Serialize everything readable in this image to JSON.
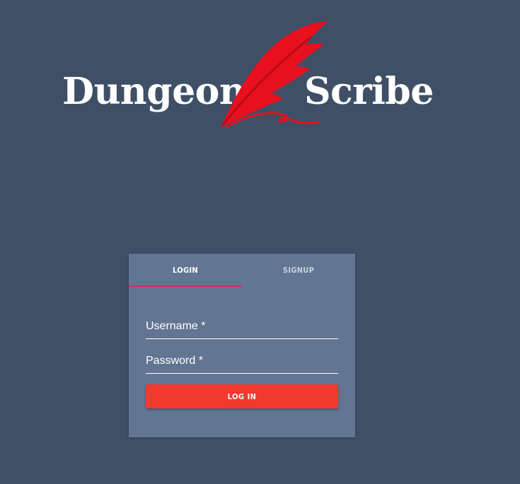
{
  "brand": {
    "word_left": "Dungeon",
    "word_right": "Scribe",
    "quill_icon": "quill-feather-icon",
    "quill_color": "#e8101e"
  },
  "tabs": [
    {
      "label": "LOGIN",
      "active": true
    },
    {
      "label": "SIGNUP",
      "active": false
    }
  ],
  "form": {
    "username_label": "Username *",
    "password_label": "Password *",
    "submit_label": "LOG IN"
  },
  "colors": {
    "background": "#3f4f65",
    "card": "#627592",
    "tab_indicator": "#e0245e",
    "button": "#f2392d"
  }
}
